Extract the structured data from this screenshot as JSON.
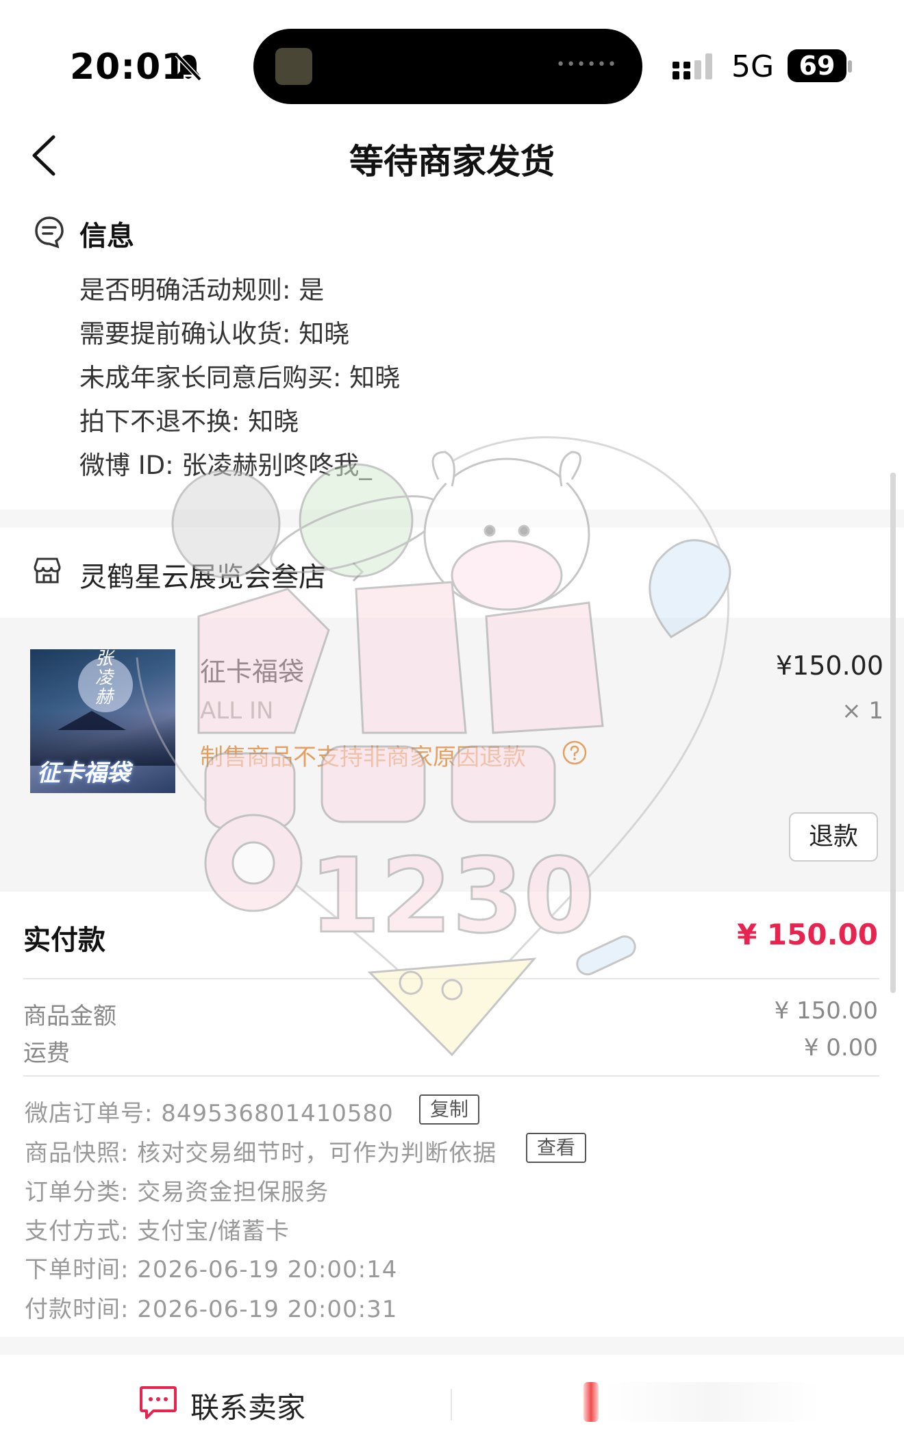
{
  "status_bar": {
    "time": "20:01",
    "network": "5G",
    "battery": "69"
  },
  "header": {
    "title": "等待商家发货"
  },
  "info": {
    "title": "信息",
    "lines": [
      "是否明确活动规则: 是",
      "需要提前确认收货: 知晓",
      "未成年家长同意后购买: 知晓",
      "拍下不退不换: 知晓",
      "微博 ID: 张凌赫别咚咚我_"
    ]
  },
  "shop": {
    "name": "灵鹤星云展览会叁店"
  },
  "product": {
    "name": "征卡福袋",
    "spec": "ALL IN",
    "warning": "制售商品不支持非商家原因退款",
    "price": "¥150.00",
    "quantity": "× 1",
    "refund_label": "退款",
    "thumb_text": "征卡福袋",
    "thumb_vertical": "张凌赫"
  },
  "payment": {
    "paid_label": "实付款",
    "paid_value": "¥ 150.00",
    "goods_label": "商品金额",
    "goods_value": "¥ 150.00",
    "shipping_label": "运费",
    "shipping_value": "¥ 0.00"
  },
  "order": {
    "number_line": "微店订单号:  849536801410580",
    "copy_label": "复制",
    "snapshot_line": "商品快照: 核对交易细节时，可作为判断依据",
    "view_label": "查看",
    "category_line": "订单分类:  交易资金担保服务",
    "payment_method_line": "支付方式:  支付宝/储蓄卡",
    "order_time_line": "下单时间:  2026-06-19 20:00:14",
    "pay_time_line": "付款时间:  2026-06-19 20:00:31"
  },
  "bottom_bar": {
    "contact_label": "联系卖家"
  },
  "watermark": {
    "text": "1230"
  },
  "colors": {
    "accent_red": "#e6244f",
    "warning_orange": "#e3a061"
  }
}
